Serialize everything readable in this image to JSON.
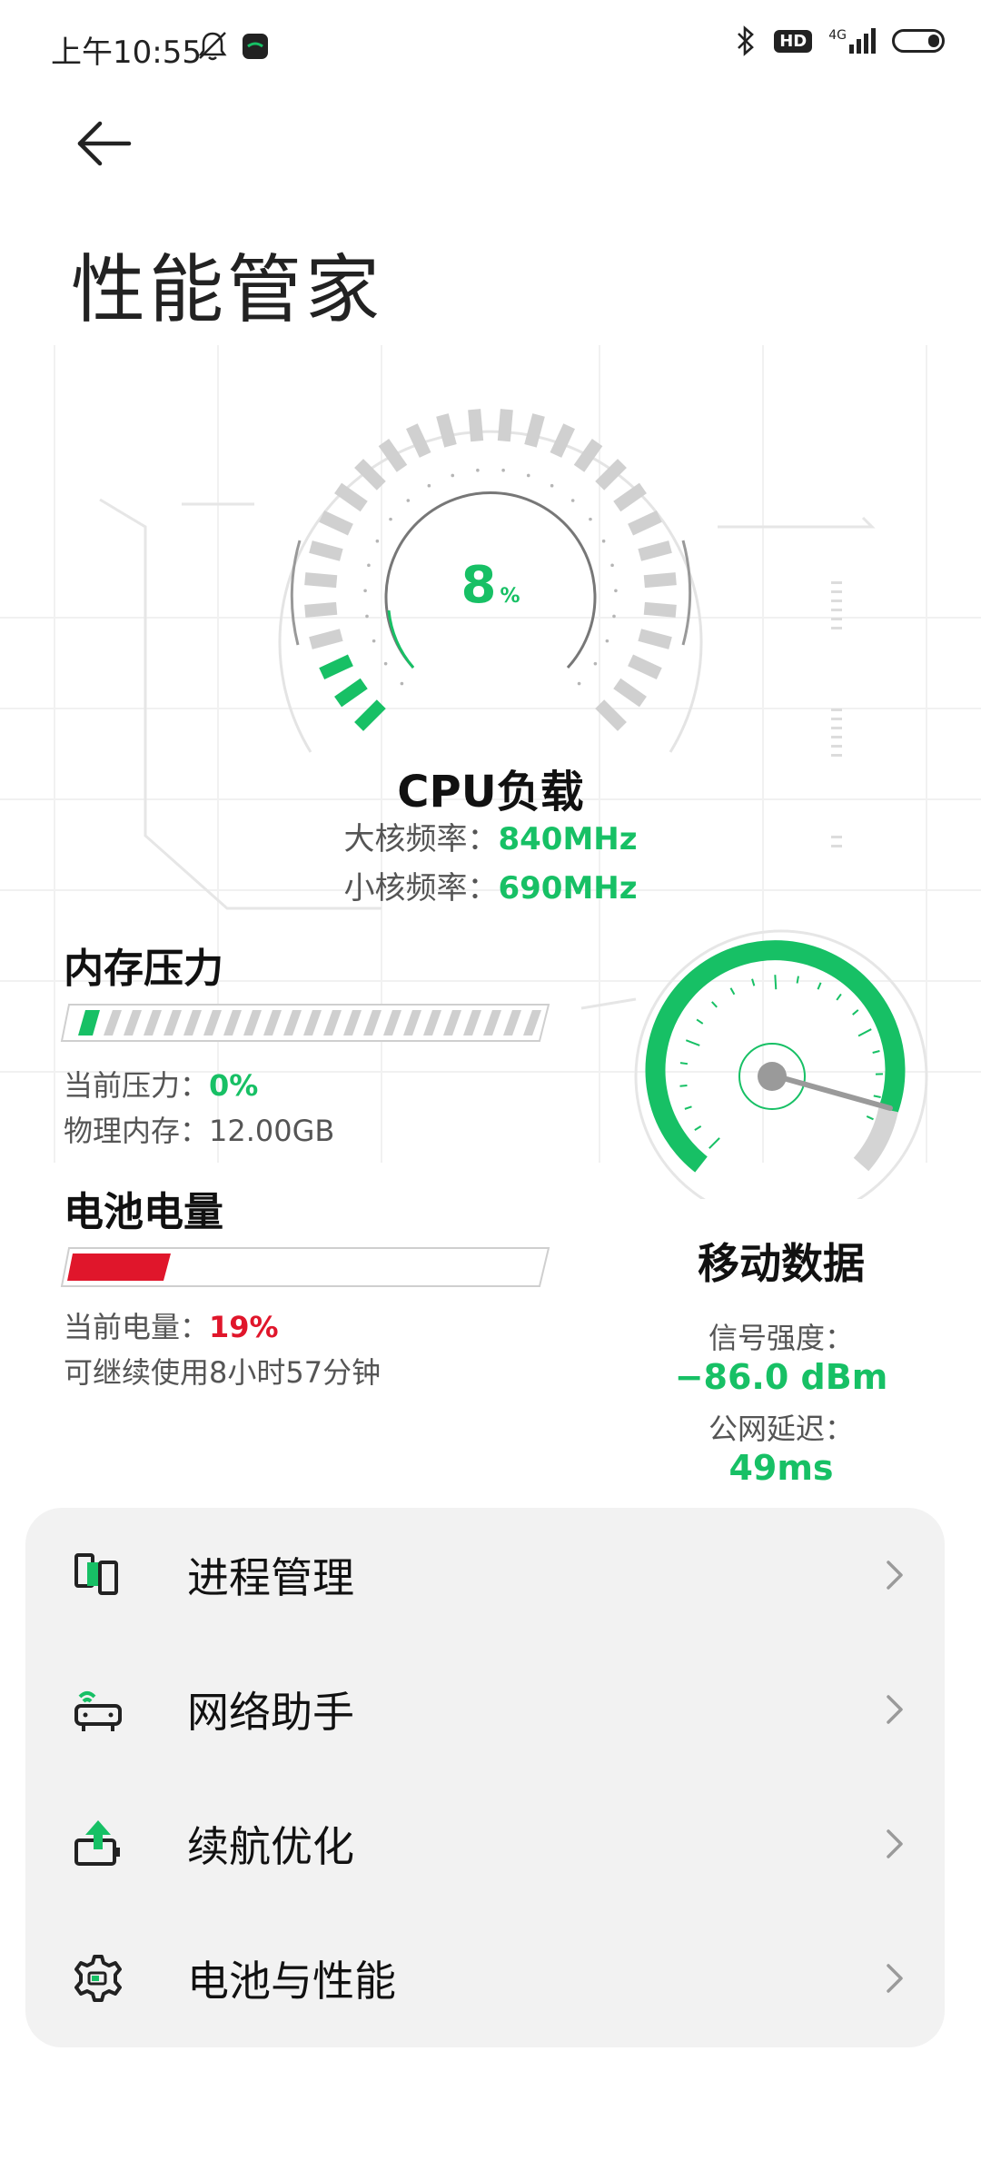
{
  "status_bar": {
    "time": "上午10:55",
    "hd": "HD",
    "network": "4G",
    "icons": [
      "bell-off-icon",
      "app-notification-icon",
      "bluetooth-icon",
      "signal-icon",
      "battery-icon"
    ]
  },
  "header": {
    "back_icon": "arrow-left-icon",
    "title": "性能管家"
  },
  "cpu": {
    "percent": "8",
    "percent_unit": "%",
    "title": "CPU负载",
    "big_core_label": "大核频率：",
    "big_core_value": "840MHz",
    "small_core_label": "小核频率：",
    "small_core_value": "690MHz"
  },
  "memory": {
    "title": "内存压力",
    "pressure_label": "当前压力：",
    "pressure_value": "0%",
    "physical_label": "物理内存：",
    "physical_value": "12.00GB",
    "level": 0.0
  },
  "battery": {
    "title": "电池电量",
    "level_label": "当前电量：",
    "level_value": "19%",
    "remaining": "可继续使用8小时57分钟",
    "level": 0.19
  },
  "mobile_data": {
    "title": "移动数据",
    "signal_label": "信号强度：",
    "signal_value": "−86.0 dBm",
    "latency_label": "公网延迟：",
    "latency_value": "49ms"
  },
  "menu": [
    {
      "label": "进程管理",
      "icon": "process-manager-icon"
    },
    {
      "label": "网络助手",
      "icon": "router-wifi-icon"
    },
    {
      "label": "续航优化",
      "icon": "battery-boost-icon"
    },
    {
      "label": "电池与性能",
      "icon": "gear-battery-icon"
    }
  ],
  "colors": {
    "accent": "#17c065",
    "warning": "#e0162b",
    "card": "#f2f2f2"
  }
}
